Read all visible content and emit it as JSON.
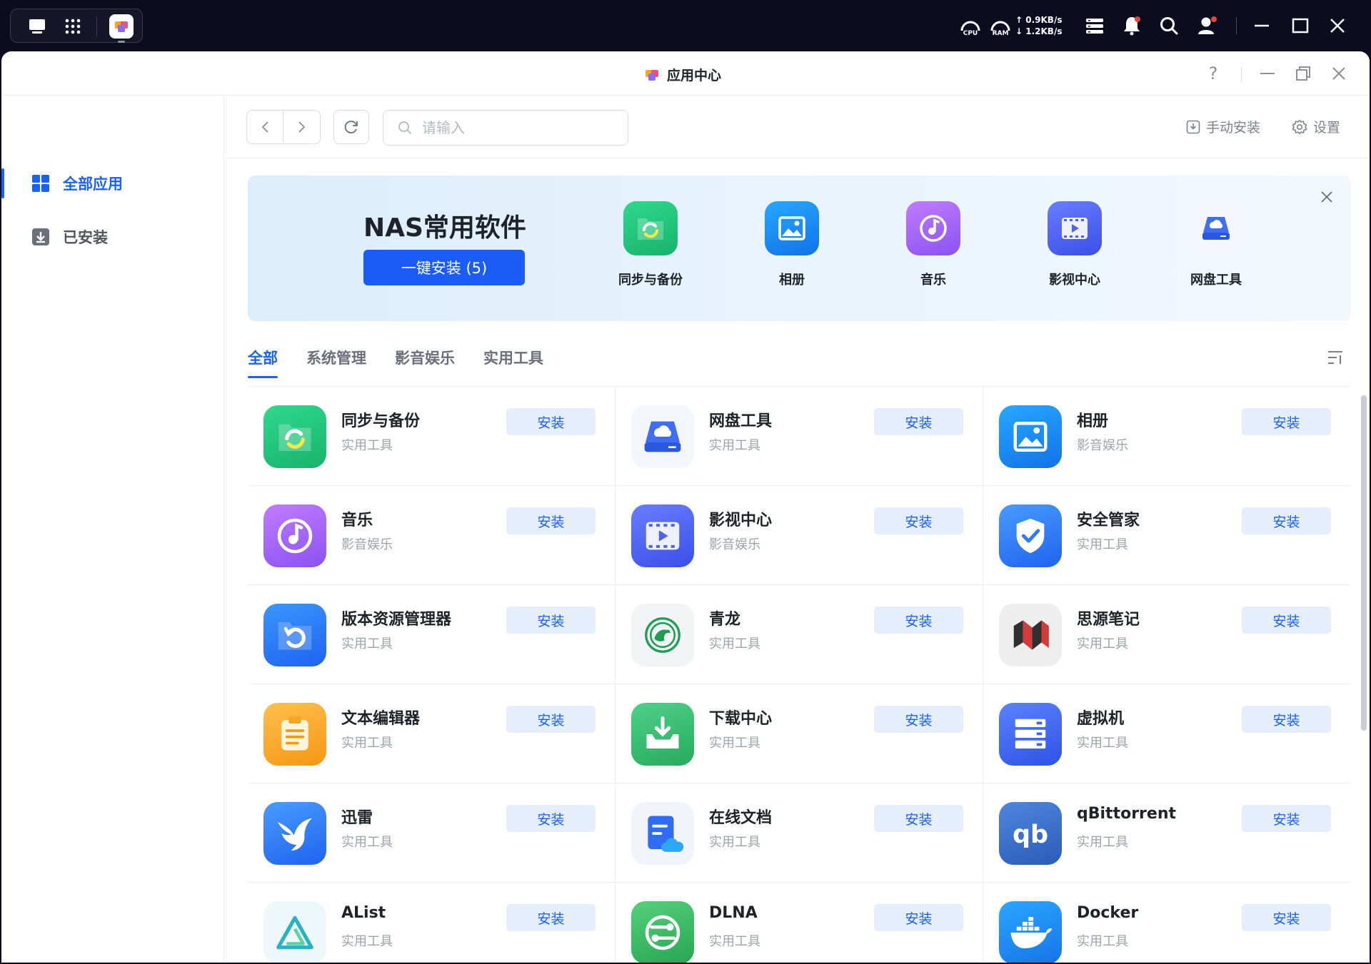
{
  "taskbar": {
    "cpu_label": "CPU",
    "ram_label": "RAM",
    "upload_speed": "0.9KB/s",
    "download_speed": "1.2KB/s"
  },
  "window": {
    "title": "应用中心"
  },
  "sidebar": {
    "items": [
      {
        "label": "全部应用",
        "icon": "grid-icon"
      },
      {
        "label": "已安装",
        "icon": "download-box-icon"
      }
    ]
  },
  "toolbar": {
    "search_placeholder": "请输入",
    "manual_install": "手动安装",
    "settings": "设置"
  },
  "banner": {
    "title": "NAS常用软件",
    "install_all": "一键安装 (5)",
    "apps": [
      {
        "label": "同步与备份"
      },
      {
        "label": "相册"
      },
      {
        "label": "音乐"
      },
      {
        "label": "影视中心"
      },
      {
        "label": "网盘工具"
      }
    ]
  },
  "tabs": [
    {
      "label": "全部"
    },
    {
      "label": "系统管理"
    },
    {
      "label": "影音娱乐"
    },
    {
      "label": "实用工具"
    }
  ],
  "install_label": "安装",
  "apps": [
    {
      "name": "同步与备份",
      "category": "实用工具",
      "icon": "sync-icon",
      "color": "#22c37e"
    },
    {
      "name": "网盘工具",
      "category": "实用工具",
      "icon": "cloud-drive-icon",
      "color": "#3d6ef5"
    },
    {
      "name": "相册",
      "category": "影音娱乐",
      "icon": "photo-icon",
      "color": "#1e8ff5"
    },
    {
      "name": "音乐",
      "category": "影音娱乐",
      "icon": "music-icon",
      "color": "#9b5ff3"
    },
    {
      "name": "影视中心",
      "category": "影音娱乐",
      "icon": "video-icon",
      "color": "#4d62f3"
    },
    {
      "name": "安全管家",
      "category": "实用工具",
      "icon": "shield-icon",
      "color": "#2c7cf6"
    },
    {
      "name": "版本资源管理器",
      "category": "实用工具",
      "icon": "folder-restore-icon",
      "color": "#2e7bf5"
    },
    {
      "name": "青龙",
      "category": "实用工具",
      "icon": "qinglong-icon",
      "color": "#1f9d55"
    },
    {
      "name": "思源笔记",
      "category": "实用工具",
      "icon": "siyuan-icon",
      "color": "#d23b3b"
    },
    {
      "name": "文本编辑器",
      "category": "实用工具",
      "icon": "clipboard-icon",
      "color": "#f6a623"
    },
    {
      "name": "下载中心",
      "category": "实用工具",
      "icon": "download-icon",
      "color": "#34b96a"
    },
    {
      "name": "虚拟机",
      "category": "实用工具",
      "icon": "server-icon",
      "color": "#3b63f0"
    },
    {
      "name": "迅雷",
      "category": "实用工具",
      "icon": "thunder-bird-icon",
      "color": "#2f7cf6"
    },
    {
      "name": "在线文档",
      "category": "实用工具",
      "icon": "doc-cloud-icon",
      "color": "#2f6df5"
    },
    {
      "name": "qBittorrent",
      "category": "实用工具",
      "icon": "qbittorrent-icon",
      "color": "#2f65c8"
    },
    {
      "name": "AList",
      "category": "实用工具",
      "icon": "alist-icon",
      "color": "#27b3c4"
    },
    {
      "name": "DLNA",
      "category": "实用工具",
      "icon": "dlna-icon",
      "color": "#2fb35f"
    },
    {
      "name": "Docker",
      "category": "实用工具",
      "icon": "docker-icon",
      "color": "#1d8cf0"
    }
  ]
}
